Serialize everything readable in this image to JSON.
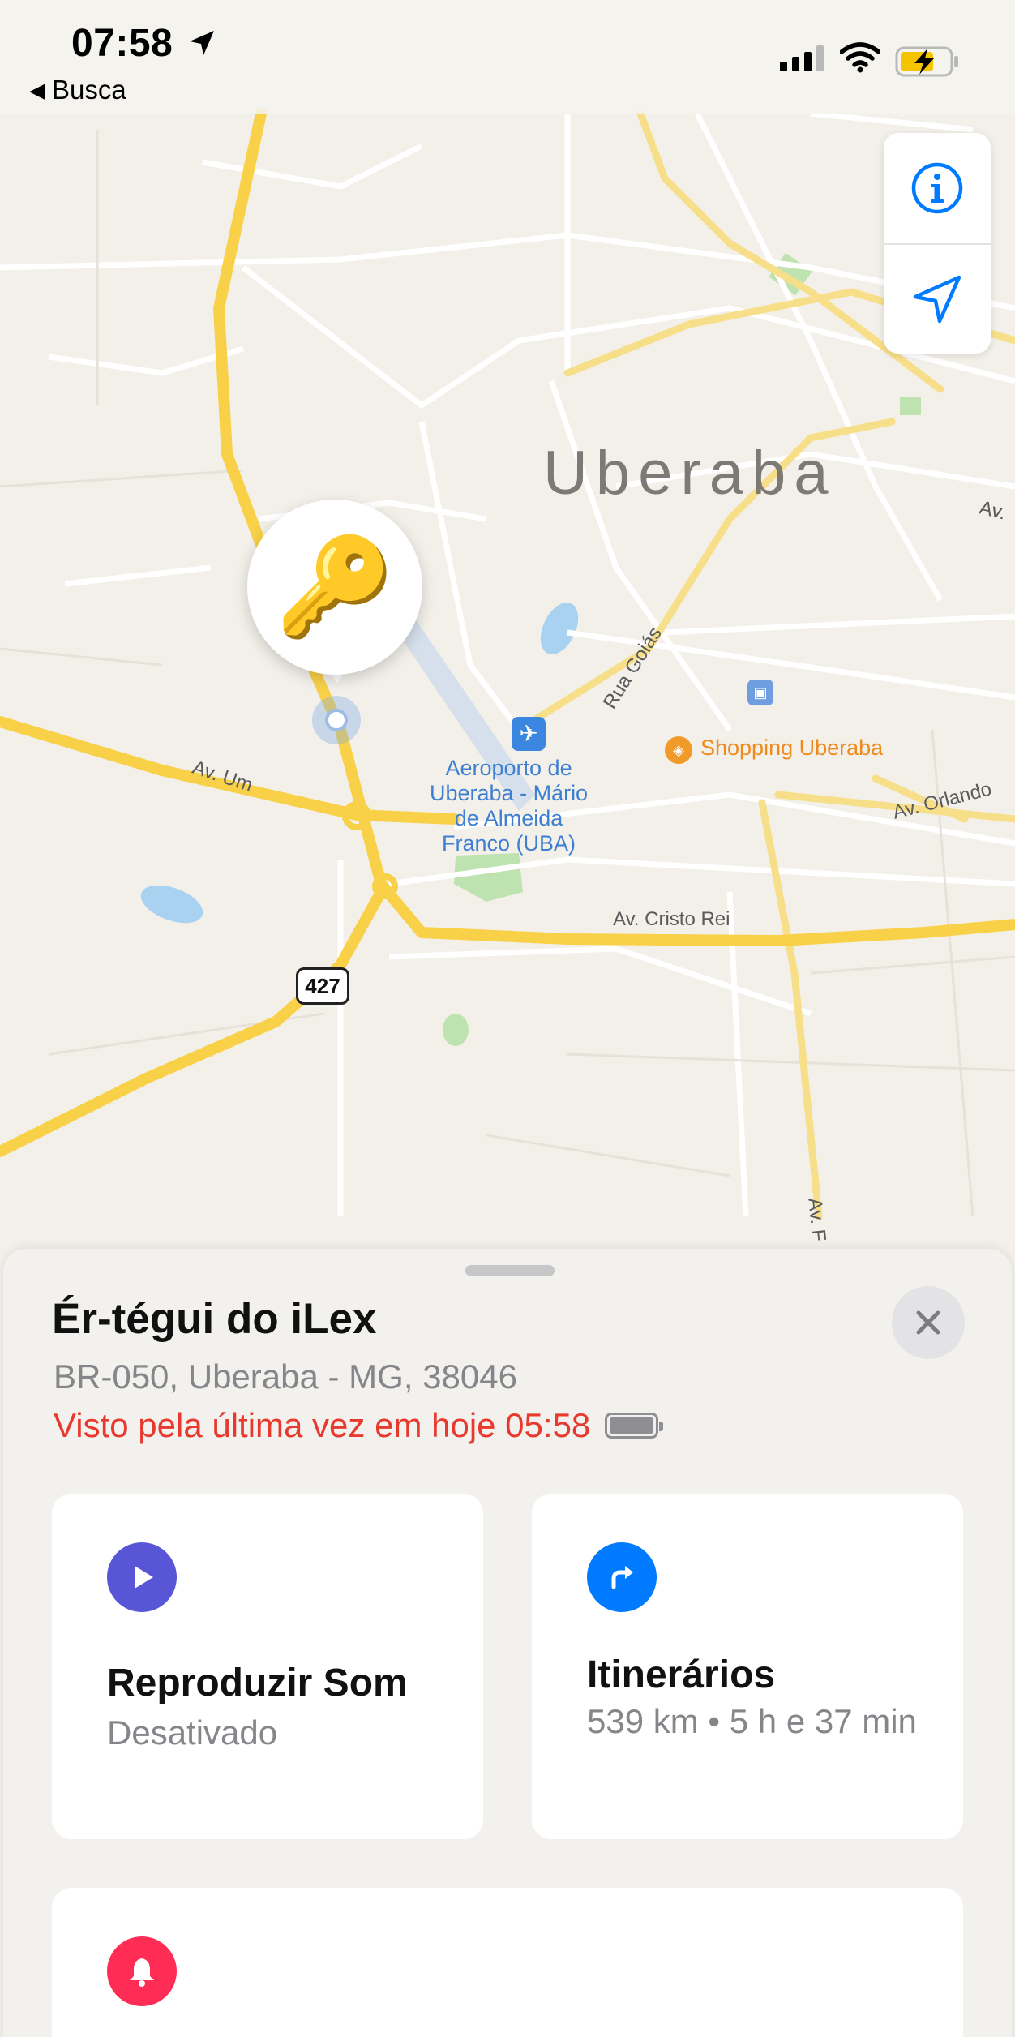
{
  "status_bar": {
    "time": "07:58",
    "back_label": "Busca"
  },
  "map": {
    "city": "Uberaba",
    "roads": {
      "av_um": "Av. Um",
      "av_cristo_rei": "Av. Cristo Rei",
      "av_orlando": "Av. Orlando",
      "rua_goias": "Rua Goiás",
      "av_top": "Av.",
      "av_f": "Av. F",
      "highway": "427"
    },
    "pois": {
      "airport": [
        "Aeroporto de",
        "Uberaba - Mário",
        "de Almeida",
        "Franco (UBA)"
      ],
      "shopping": "Shopping Uberaba"
    },
    "pin_icon": "key-emoji",
    "controls": [
      "info-icon",
      "location-arrow-icon"
    ]
  },
  "item": {
    "name": "Ér-tégui do iLex",
    "address": "BR-050, Uberaba - MG, 38046",
    "last_seen": "Visto pela última vez em hoje 05:58"
  },
  "actions": {
    "sound": {
      "title": "Reproduzir Som",
      "status": "Desativado",
      "color": "#5856d6"
    },
    "directions": {
      "title": "Itinerários",
      "detail": "539 km • 5 h e 37 min",
      "color": "#007aff"
    },
    "notify": {
      "color": "#ff2d55"
    }
  }
}
